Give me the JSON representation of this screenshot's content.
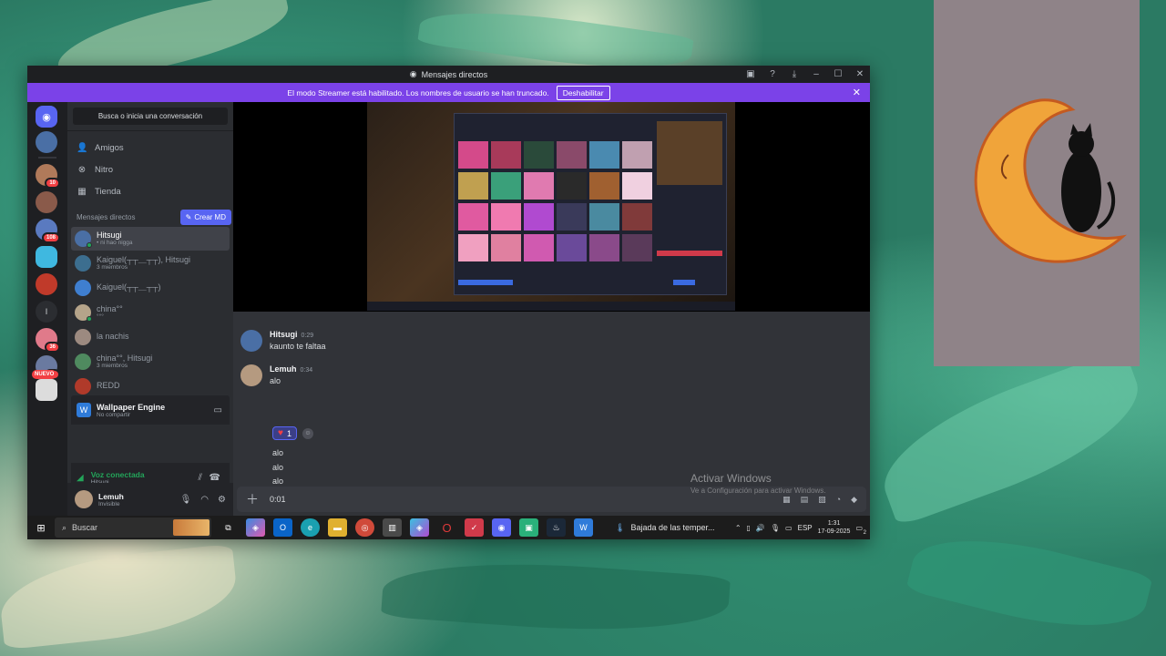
{
  "window": {
    "title": "Mensajes directos"
  },
  "banner": {
    "text": "El modo Streamer está habilitado. Los nombres de usuario se han truncado.",
    "button": "Deshabilitar"
  },
  "rail": {
    "badges": [
      "10",
      "108",
      "36",
      "44"
    ],
    "letter": "l",
    "new_label": "NUEVO"
  },
  "sidebar": {
    "search_label": "Busca o inicia una conversación",
    "nav": [
      {
        "label": "Amigos",
        "icon": "friends-icon"
      },
      {
        "label": "Nitro",
        "icon": "nitro-icon"
      },
      {
        "label": "Tienda",
        "icon": "shop-icon"
      }
    ],
    "dm_header": "Mensajes directos",
    "create_dm": "Crear MD",
    "dms": [
      {
        "name": "Hitsugi",
        "sub": "• ni hao nigga",
        "active": true
      },
      {
        "name": "Kaiguel(┬┬＿┬┬), Hitsugi",
        "sub": "3 miembros"
      },
      {
        "name": "Kaiguel(┬┬＿┬┬)",
        "sub": ""
      },
      {
        "name": "china°°",
        "sub": "°°°"
      },
      {
        "name": "la nachis",
        "sub": ""
      },
      {
        "name": "china°°, Hitsugi",
        "sub": "3 miembros"
      },
      {
        "name": "REDD",
        "sub": ""
      }
    ],
    "activity": {
      "title": "Wallpaper Engine",
      "sub": "No compartir"
    },
    "voice": {
      "title": "Voz conectada",
      "sub": "Hitsugi"
    },
    "user": {
      "name": "Lemuh",
      "status": "Invisible"
    }
  },
  "chat": {
    "messages": [
      {
        "author": "Hitsugi",
        "time": "0:29",
        "text": "kaunto te faltaa"
      },
      {
        "author": "Lemuh",
        "time": "0:34",
        "text": "alo"
      }
    ],
    "reaction_count": "1",
    "extra_lines": [
      "alo",
      "alo",
      "alo",
      "alo"
    ],
    "composer_value": "0:01"
  },
  "watermark": {
    "title": "Activar Windows",
    "sub": "Ve a Configuración para activar Windows."
  },
  "taskbar": {
    "search": "Buscar",
    "news": "Bajada de las temper...",
    "lang": "ESP",
    "time": "1:31",
    "date": "17-09-2025",
    "notif_count": "2"
  },
  "colors": {
    "accent": "#5865f2",
    "streamer_banner": "#7b42e8",
    "online": "#23a55a",
    "badge": "#f23f43"
  }
}
